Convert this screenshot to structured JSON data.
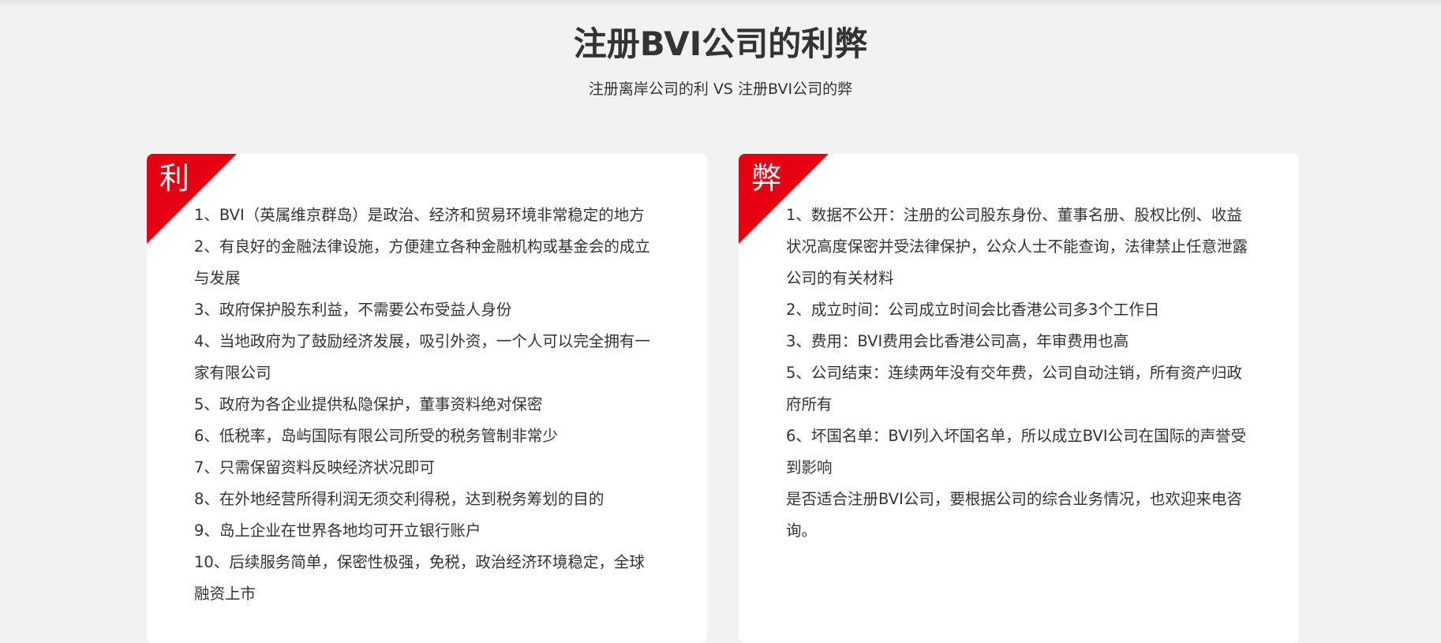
{
  "header": {
    "title": "注册BVI公司的利弊",
    "subtitle": "注册离岸公司的利 VS 注册BVI公司的弊"
  },
  "pros": {
    "badge": "利",
    "items": [
      "1、BVI（英属维京群岛）是政治、经济和贸易环境非常稳定的地方",
      "2、有良好的金融法律设施，方便建立各种金融机构或基金会的成立与发展",
      "3、政府保护股东利益，不需要公布受益人身份",
      "4、当地政府为了鼓励经济发展，吸引外资，一个人可以完全拥有一家有限公司",
      "5、政府为各企业提供私隐保护，董事资料绝对保密",
      "6、低税率，岛屿国际有限公司所受的税务管制非常少",
      "7、只需保留资料反映经济状况即可",
      "8、在外地经营所得利润无须交利得税，达到税务筹划的目的",
      "9、岛上企业在世界各地均可开立银行账户",
      "10、后续服务简单，保密性极强，免税，政治经济环境稳定，全球融资上市"
    ]
  },
  "cons": {
    "badge": "弊",
    "items": [
      "1、数据不公开：注册的公司股东身份、董事名册、股权比例、收益状况高度保密并受法律保护，公众人士不能查询，法律禁止任意泄露公司的有关材料",
      "2、成立时间：公司成立时间会比香港公司多3个工作日",
      "3、费用：BVI费用会比香港公司高，年审费用也高",
      "5、公司结束：连续两年没有交年费，公司自动注销，所有资产归政府所有",
      "6、坏国名单：BVI列入坏国名单，所以成立BVI公司在国际的声誉受到影响",
      "是否适合注册BVI公司，要根据公司的综合业务情况，也欢迎来电咨询。"
    ]
  },
  "colors": {
    "accent": "#e50012",
    "background": "#f2f2f2",
    "card": "#ffffff",
    "text": "#333333"
  }
}
